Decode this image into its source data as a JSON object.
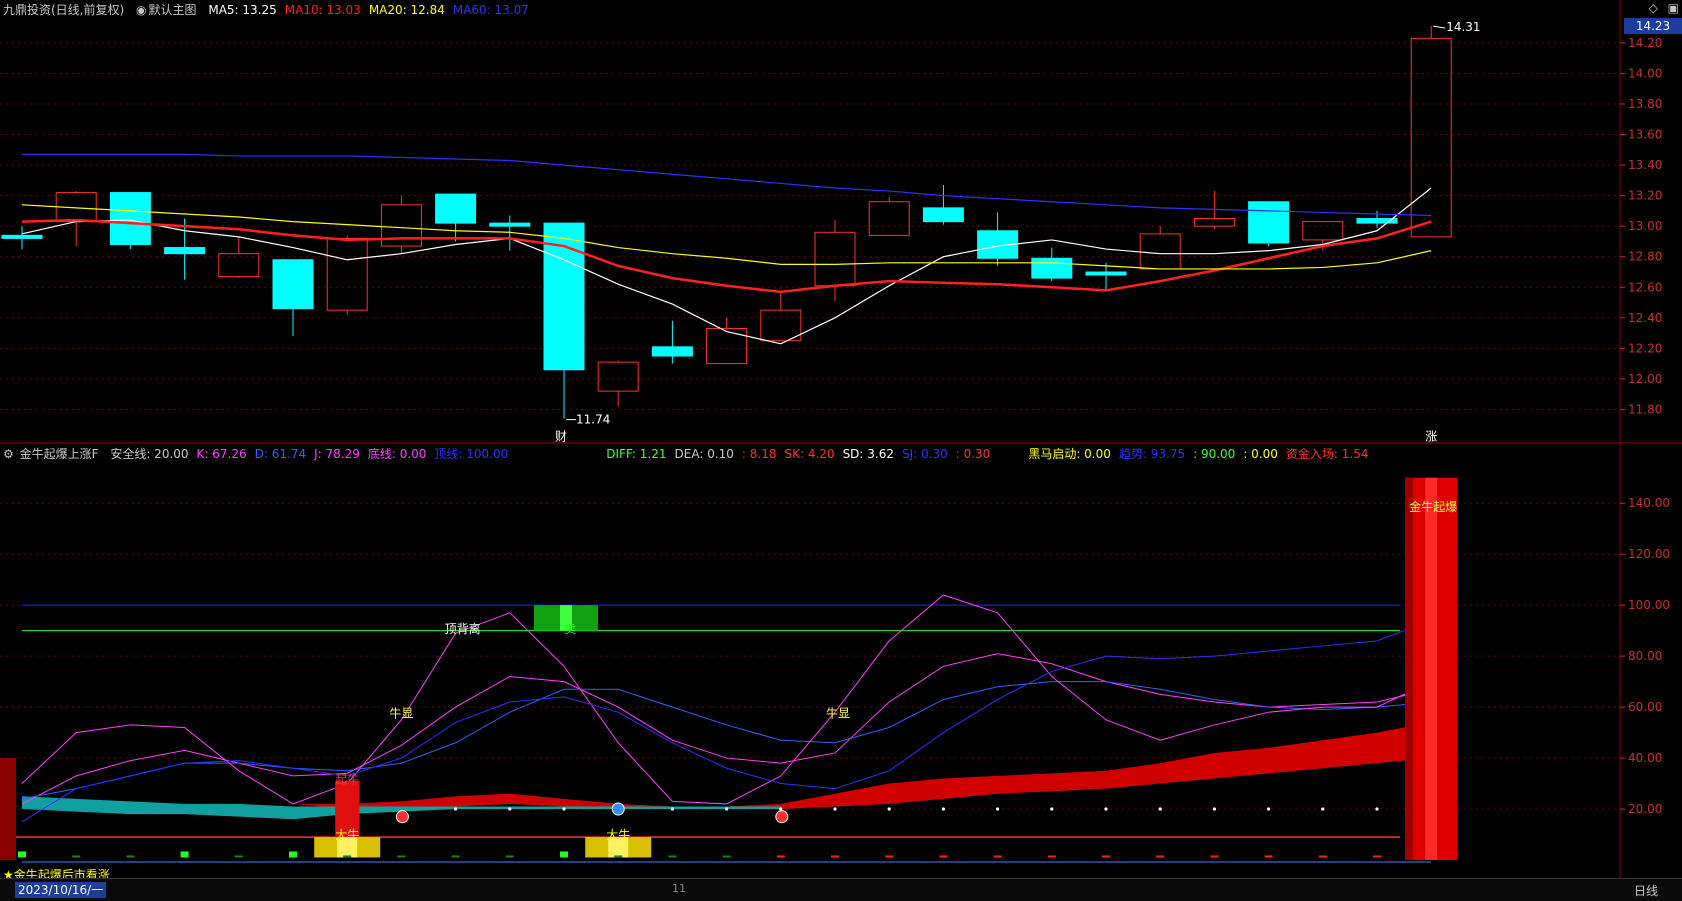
{
  "main_header": {
    "title": "九鼎投资(日线,前复权)",
    "template": "默认主图",
    "ma": [
      {
        "label": "MA5: 13.25",
        "color": "#ffffff"
      },
      {
        "label": "MA10: 13.03",
        "color": "#ff2020"
      },
      {
        "label": "MA20: 12.84",
        "color": "#ffff00"
      },
      {
        "label": "MA60: 13.07",
        "color": "#3030ff"
      }
    ]
  },
  "ind_header": {
    "name": "金牛起爆上涨F",
    "items": [
      {
        "label": "安全线: 20.00",
        "color": "#c8c8c8"
      },
      {
        "label": "K: 67.26",
        "color": "#ff40ff"
      },
      {
        "label": "D: 61.74",
        "color": "#3060ff"
      },
      {
        "label": "J: 78.29",
        "color": "#ff40ff"
      },
      {
        "label": "底线: 0.00",
        "color": "#ff40ff"
      },
      {
        "label": "顶线: 100.00",
        "color": "#3030ff"
      },
      {
        "label": "DIFF: 1.21",
        "color": "#40ff40"
      },
      {
        "label": "DEA: 0.10",
        "color": "#c8c8c8"
      },
      {
        "label": ": 8.18",
        "color": "#ff3030"
      },
      {
        "label": "SK: 4.20",
        "color": "#ff3030"
      },
      {
        "label": "SD: 3.62",
        "color": "#ffffff"
      },
      {
        "label": "SJ: 0.30",
        "color": "#3030ff"
      },
      {
        "label": ": 0.30",
        "color": "#ff3030"
      },
      {
        "label": "黑马启动: 0.00",
        "color": "#ffff00"
      },
      {
        "label": "趋势: 93.75",
        "color": "#3030ff"
      },
      {
        "label": ": 90.00",
        "color": "#40ff40"
      },
      {
        "label": ": 0.00",
        "color": "#ffff00"
      },
      {
        "label": "资金入场: 1.54",
        "color": "#ff3030"
      }
    ]
  },
  "price_tag": "14.23",
  "price_axis": [
    "14.20",
    "14.00",
    "13.80",
    "13.60",
    "13.40",
    "13.20",
    "13.00",
    "12.80",
    "12.60",
    "12.40",
    "12.20",
    "12.00",
    "11.80"
  ],
  "ind_axis": [
    "140.00",
    "120.00",
    "100.00",
    "80.00",
    "60.00",
    "40.00",
    "20.00"
  ],
  "annotations": {
    "high": "14.31",
    "low": "11.74",
    "cai": "财",
    "zhang": "涨",
    "top_divergence": "顶背离",
    "sell": "卖",
    "niu_xian_1": "牛显",
    "niu_xian_2": "牛显",
    "qi_niu": "起牛",
    "da_niu_1": "大牛",
    "da_niu_2": "大牛",
    "golden_bull": "金牛起爆"
  },
  "hint": "★金牛起爆后市看涨",
  "date": "2023/10/16/一",
  "x_tick": "11",
  "period": "日线",
  "colors": {
    "up": "#ff3030",
    "down": "#00ffff",
    "grid": "#6e0000"
  },
  "chart_data": [
    {
      "type": "candlestick",
      "title": "九鼎投资(日线,前复权)",
      "ylim": [
        11.6,
        14.35
      ],
      "candles": [
        {
          "o": 12.94,
          "h": 13.0,
          "l": 12.85,
          "c": 12.92
        },
        {
          "o": 13.03,
          "h": 13.23,
          "l": 12.87,
          "c": 13.22
        },
        {
          "o": 13.22,
          "h": 13.22,
          "l": 12.85,
          "c": 12.88
        },
        {
          "o": 12.86,
          "h": 13.05,
          "l": 12.65,
          "c": 12.82
        },
        {
          "o": 12.67,
          "h": 12.93,
          "l": 12.66,
          "c": 12.82
        },
        {
          "o": 12.78,
          "h": 12.78,
          "l": 12.28,
          "c": 12.46
        },
        {
          "o": 12.45,
          "h": 12.94,
          "l": 12.42,
          "c": 12.92
        },
        {
          "o": 12.87,
          "h": 13.2,
          "l": 12.82,
          "c": 13.14
        },
        {
          "o": 13.21,
          "h": 13.21,
          "l": 12.9,
          "c": 13.02
        },
        {
          "o": 13.02,
          "h": 13.07,
          "l": 12.84,
          "c": 13.0
        },
        {
          "o": 13.02,
          "h": 13.02,
          "l": 11.74,
          "c": 12.06
        },
        {
          "o": 11.92,
          "h": 12.12,
          "l": 11.82,
          "c": 12.11
        },
        {
          "o": 12.21,
          "h": 12.38,
          "l": 12.1,
          "c": 12.15
        },
        {
          "o": 12.1,
          "h": 12.4,
          "l": 12.1,
          "c": 12.33
        },
        {
          "o": 12.25,
          "h": 12.56,
          "l": 12.25,
          "c": 12.45
        },
        {
          "o": 12.61,
          "h": 13.04,
          "l": 12.51,
          "c": 12.96
        },
        {
          "o": 12.94,
          "h": 13.19,
          "l": 12.94,
          "c": 13.16
        },
        {
          "o": 13.12,
          "h": 13.27,
          "l": 13.01,
          "c": 13.03
        },
        {
          "o": 12.97,
          "h": 13.09,
          "l": 12.74,
          "c": 12.79
        },
        {
          "o": 12.79,
          "h": 12.86,
          "l": 12.64,
          "c": 12.66
        },
        {
          "o": 12.7,
          "h": 12.76,
          "l": 12.58,
          "c": 12.68
        },
        {
          "o": 12.72,
          "h": 13.0,
          "l": 12.72,
          "c": 12.95
        },
        {
          "o": 13.0,
          "h": 13.23,
          "l": 12.98,
          "c": 13.05
        },
        {
          "o": 13.16,
          "h": 13.16,
          "l": 12.87,
          "c": 12.89
        },
        {
          "o": 12.91,
          "h": 13.03,
          "l": 12.84,
          "c": 13.03
        },
        {
          "o": 13.05,
          "h": 13.1,
          "l": 12.99,
          "c": 13.02
        },
        {
          "o": 12.93,
          "h": 14.31,
          "l": 12.93,
          "c": 14.23
        }
      ],
      "series": [
        {
          "name": "MA5",
          "color": "#ffffff",
          "values": [
            12.95,
            13.03,
            13.04,
            12.97,
            12.93,
            12.86,
            12.78,
            12.82,
            12.88,
            12.92,
            12.78,
            12.62,
            12.49,
            12.31,
            12.23,
            12.4,
            12.61,
            12.8,
            12.87,
            12.91,
            12.85,
            12.82,
            12.82,
            12.84,
            12.88,
            12.97,
            13.25
          ]
        },
        {
          "name": "MA10",
          "color": "#ff2020",
          "values": [
            13.03,
            13.04,
            13.02,
            13.0,
            12.98,
            12.94,
            12.91,
            12.92,
            12.92,
            12.92,
            12.87,
            12.74,
            12.66,
            12.61,
            12.57,
            12.61,
            12.64,
            12.63,
            12.62,
            12.6,
            12.58,
            12.64,
            12.71,
            12.79,
            12.87,
            12.92,
            13.03
          ]
        },
        {
          "name": "MA20",
          "color": "#ffff00",
          "values": [
            13.14,
            13.12,
            13.1,
            13.08,
            13.06,
            13.03,
            13.01,
            12.99,
            12.97,
            12.96,
            12.92,
            12.86,
            12.82,
            12.79,
            12.75,
            12.75,
            12.76,
            12.76,
            12.76,
            12.76,
            12.74,
            12.72,
            12.72,
            12.72,
            12.73,
            12.76,
            12.84
          ]
        },
        {
          "name": "MA60",
          "color": "#3030ff",
          "values": [
            13.47,
            13.47,
            13.47,
            13.47,
            13.46,
            13.46,
            13.46,
            13.45,
            13.44,
            13.43,
            13.4,
            13.37,
            13.34,
            13.31,
            13.28,
            13.25,
            13.23,
            13.2,
            13.18,
            13.16,
            13.14,
            13.12,
            13.11,
            13.1,
            13.09,
            13.08,
            13.07
          ]
        }
      ]
    },
    {
      "type": "line",
      "title": "金牛起爆上涨F",
      "ylim": [
        0,
        155
      ],
      "series": [
        {
          "name": "K",
          "color": "#ff40ff",
          "values": [
            22,
            33,
            39,
            43,
            38,
            33,
            34,
            45,
            60,
            72,
            70,
            60,
            47,
            40,
            38,
            42,
            62,
            76,
            81,
            77,
            70,
            65,
            62,
            60,
            61,
            62,
            67
          ]
        },
        {
          "name": "D",
          "color": "#3060ff",
          "values": [
            24,
            28,
            33,
            38,
            38,
            36,
            35,
            38,
            46,
            58,
            67,
            67,
            60,
            53,
            47,
            46,
            52,
            63,
            68,
            70,
            70,
            67,
            63,
            60,
            59,
            60,
            62
          ]
        },
        {
          "name": "J",
          "color": "#ff40ff",
          "values": [
            30,
            50,
            53,
            52,
            35,
            22,
            30,
            55,
            89,
            97,
            76,
            46,
            23,
            22,
            33,
            58,
            86,
            104,
            97,
            72,
            55,
            47,
            53,
            58,
            60,
            60,
            70
          ]
        },
        {
          "name": "趋势",
          "color": "#3030ff",
          "values": [
            15,
            28,
            33,
            38,
            39,
            36,
            33,
            40,
            54,
            62,
            64,
            58,
            46,
            36,
            30,
            28,
            35,
            50,
            63,
            74,
            80,
            79,
            80,
            82,
            84,
            86,
            94
          ]
        }
      ]
    }
  ]
}
